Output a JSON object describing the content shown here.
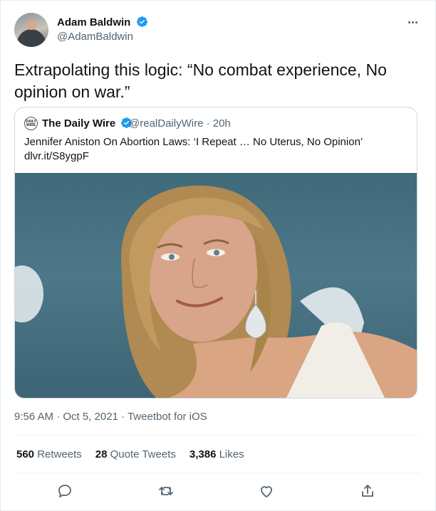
{
  "author": {
    "display_name": "Adam Baldwin",
    "handle": "@AdamBaldwin",
    "verified": true,
    "avatar_icon": "profile-photo"
  },
  "tweet": {
    "text": "Extrapolating this logic: “No combat experience, No opinion on war.”"
  },
  "quoted": {
    "avatar_label": "DAILY WIRE",
    "display_name": "The Daily Wire",
    "handle_time": "@realDailyWire · 20h",
    "text": "Jennifer Aniston On Abortion Laws: ‘I Repeat … No Uterus, No Opinion’",
    "link": "dlvr.it/S8ygpF"
  },
  "meta": {
    "timestamp": "9:56 AM · Oct 5, 2021 · Tweetbot for iOS"
  },
  "stats": {
    "retweets_count": "560",
    "retweets_label": "Retweets",
    "quotes_count": "28",
    "quotes_label": "Quote Tweets",
    "likes_count": "3,386",
    "likes_label": "Likes"
  },
  "actions": [
    "reply-icon",
    "retweet-icon",
    "like-icon",
    "share-icon"
  ],
  "colors": {
    "verified_blue": "#1d9bf0",
    "secondary_text": "#536471",
    "border": "#cfd9de"
  }
}
